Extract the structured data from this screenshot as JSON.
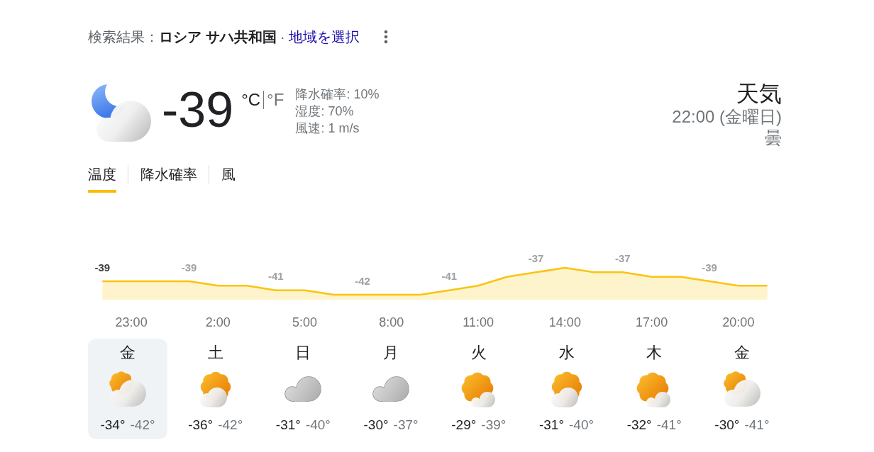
{
  "location_line": {
    "text": "検索結果：**ロシア サハ共和国** ·",
    "link": "地域を選択"
  },
  "current": {
    "temperature": "-39",
    "units": [
      {
        "label": "°C",
        "selected": true
      },
      {
        "label": "°F",
        "selected": false
      }
    ],
    "details": [
      "降水確率: 10%",
      "湿度: 70%",
      "風速: 1 m/s"
    ]
  },
  "summary": {
    "title": "天気",
    "time": "22:00 (金曜日)",
    "condition": "曇"
  },
  "tabs": [
    {
      "label": "温度",
      "selected": true
    },
    {
      "label": "降水確率",
      "selected": false
    },
    {
      "label": "風",
      "selected": false
    }
  ],
  "chart_data": {
    "type": "area",
    "categories": [
      null,
      "23:00",
      null,
      null,
      "2:00",
      null,
      null,
      "5:00",
      null,
      null,
      "8:00",
      null,
      null,
      "11:00",
      null,
      null,
      "14:00",
      null,
      null,
      "17:00",
      null,
      null,
      "20:00",
      null
    ],
    "values": [
      -39,
      -39,
      -39,
      -39,
      -40,
      -40,
      -41,
      -41,
      -42,
      -42,
      -42,
      -42,
      -41,
      -40,
      -38,
      -37,
      -36,
      -37,
      -37,
      -38,
      -38,
      -39,
      -40,
      -40
    ],
    "value_labels": [
      "-39",
      null,
      null,
      "-39",
      null,
      null,
      "-41",
      null,
      null,
      "-42",
      null,
      null,
      "-41",
      null,
      null,
      "-37",
      null,
      null,
      "-37",
      null,
      null,
      "-39",
      null,
      null
    ]
  },
  "days": [
    {
      "name": "金",
      "kind": "mostly-cloudy",
      "high": "-34°",
      "low": "-42°",
      "selected": true
    },
    {
      "name": "土",
      "kind": "partly-cloudy",
      "high": "-36°",
      "low": "-42°",
      "selected": false
    },
    {
      "name": "日",
      "kind": "cloudy",
      "high": "-31°",
      "low": "-40°",
      "selected": false
    },
    {
      "name": "月",
      "kind": "cloudy",
      "high": "-30°",
      "low": "-37°",
      "selected": false
    },
    {
      "name": "火",
      "kind": "mostly-sunny",
      "high": "-29°",
      "low": "-39°",
      "selected": false
    },
    {
      "name": "水",
      "kind": "partly-cloudy",
      "high": "-31°",
      "low": "-40°",
      "selected": false
    },
    {
      "name": "木",
      "kind": "mostly-sunny",
      "high": "-32°",
      "low": "-41°",
      "selected": false
    },
    {
      "name": "金",
      "kind": "mostly-cloudy",
      "high": "-30°",
      "low": "-41°",
      "selected": false
    }
  ]
}
